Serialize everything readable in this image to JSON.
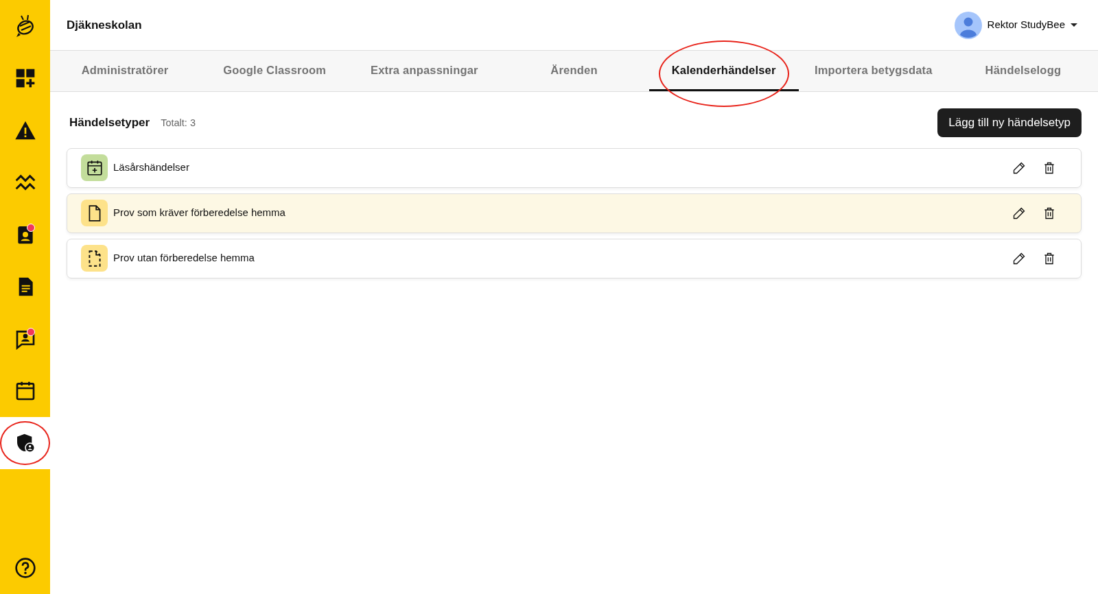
{
  "sidebar": {
    "items": [
      {
        "kind": "dashboard-add",
        "selected": false,
        "badge": false,
        "circled": false
      },
      {
        "kind": "warning",
        "selected": false,
        "badge": false,
        "circled": false
      },
      {
        "kind": "trend",
        "selected": false,
        "badge": false,
        "circled": false
      },
      {
        "kind": "id-badge",
        "selected": false,
        "badge": true,
        "circled": false
      },
      {
        "kind": "document",
        "selected": false,
        "badge": false,
        "circled": false
      },
      {
        "kind": "chat-person",
        "selected": false,
        "badge": true,
        "circled": false
      },
      {
        "kind": "calendar",
        "selected": false,
        "badge": false,
        "circled": false
      },
      {
        "kind": "shield-person",
        "selected": true,
        "badge": false,
        "circled": true
      }
    ]
  },
  "header": {
    "school": "Djäkneskolan",
    "user": "Rektor StudyBee"
  },
  "tabs": [
    {
      "label": "Administratörer",
      "selected": false,
      "circled": false
    },
    {
      "label": "Google Classroom",
      "selected": false,
      "circled": false
    },
    {
      "label": "Extra anpassningar",
      "selected": false,
      "circled": false
    },
    {
      "label": "Ärenden",
      "selected": false,
      "circled": false
    },
    {
      "label": "Kalenderhändelser",
      "selected": true,
      "circled": true
    },
    {
      "label": "Importera betygsdata",
      "selected": false,
      "circled": false
    },
    {
      "label": "Händelselogg",
      "selected": false,
      "circled": false
    }
  ],
  "section": {
    "title": "Händelsetyper",
    "total": "Totalt: 3",
    "add_button": "Lägg till ny händelsetyp"
  },
  "event_types": [
    {
      "name": "Läsårshändelser",
      "kind": "calendar-plus",
      "color": "#c3dd9b",
      "highlighted": false
    },
    {
      "name": "Prov som kräver förberedelse hemma",
      "kind": "document",
      "color": "#fde28a",
      "highlighted": true
    },
    {
      "name": "Prov utan förberedelse hemma",
      "kind": "document-dashed",
      "color": "#fde28a",
      "highlighted": false
    }
  ]
}
